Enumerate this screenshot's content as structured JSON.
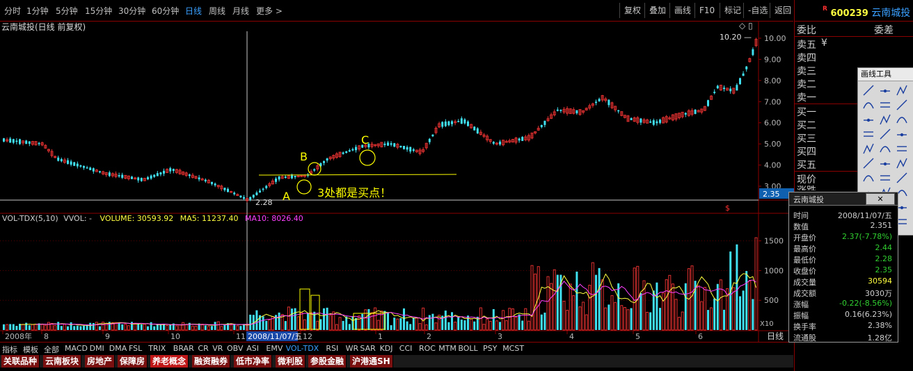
{
  "toolbar": {
    "periods": [
      "分时",
      "1分钟",
      "5分钟",
      "15分钟",
      "30分钟",
      "60分钟",
      "日线",
      "周线",
      "月线",
      "更多 >"
    ],
    "active_period": "日线",
    "right_buttons": [
      "复权",
      "叠加",
      "画线",
      "F10",
      "标记",
      "-自选",
      "返回"
    ]
  },
  "stock": {
    "code_marker": "R",
    "code": "600239",
    "name": "云南城投"
  },
  "chart": {
    "title": "云南城投(日线 前复权)",
    "high_label": "10.20",
    "low_label": "2.28",
    "current_price_tag": "2.35",
    "annotation_a": "A",
    "annotation_b": "B",
    "annotation_c": "C",
    "annotation_text": "3处都是买点！",
    "price_axis": [
      "10.00",
      "9.00",
      "8.00",
      "7.00",
      "6.00",
      "5.00",
      "4.00",
      "3.00"
    ],
    "vol_axis": [
      "1500",
      "1000",
      "500"
    ],
    "vol_multiplier": "X10",
    "vol_header": {
      "name": "VOL-TDX(5,10)",
      "vvol": "VVOL: -",
      "volume": "VOLUME: 30593.92",
      "ma5": "MA5: 11237.40",
      "ma10": "MA10: 8026.40"
    },
    "date_axis": [
      "2008年",
      "8",
      "9",
      "10",
      "11",
      "2008/11/07/五",
      "12",
      "1",
      "2",
      "3",
      "4",
      "5",
      "6"
    ],
    "period_label": "日线",
    "colors": {
      "up": "#e03030",
      "down": "#40e0f0",
      "ma5": "#ffff40",
      "ma10": "#ff40ff",
      "label": "#ffff00"
    }
  },
  "right_panel": {
    "header_left": "委比",
    "header_right": "委差",
    "sell": [
      "卖五",
      "卖四",
      "卖三",
      "卖二",
      "卖一"
    ],
    "sell5_extra": "¥",
    "buy": [
      "买一",
      "买二",
      "买三",
      "买四",
      "买五"
    ],
    "now": "现价",
    "partial": "涨跌"
  },
  "drawing_tools": {
    "title": "画线工具"
  },
  "info_popup": {
    "title": "云南城投",
    "rows": [
      {
        "k": "时间",
        "v": "2008/11/07/五",
        "c": "#d0d0d0"
      },
      {
        "k": "数值",
        "v": "2.351",
        "c": "#d0d0d0"
      },
      {
        "k": "开盘价",
        "v": "2.37(-7.78%)",
        "c": "#30d030"
      },
      {
        "k": "最高价",
        "v": "2.44",
        "c": "#30d030"
      },
      {
        "k": "最低价",
        "v": "2.28",
        "c": "#30d030"
      },
      {
        "k": "收盘价",
        "v": "2.35",
        "c": "#30d030"
      },
      {
        "k": "成交量",
        "v": "30594",
        "c": "#ffff40"
      },
      {
        "k": "成交额",
        "v": "3030万",
        "c": "#d0d0d0"
      },
      {
        "k": "涨幅",
        "v": "-0.22(-8.56%)",
        "c": "#30d030"
      },
      {
        "k": "振幅",
        "v": "0.16(6.23%)",
        "c": "#d0d0d0"
      },
      {
        "k": "换手率",
        "v": "2.38%",
        "c": "#d0d0d0"
      },
      {
        "k": "流通股",
        "v": "1.28亿",
        "c": "#d0d0d0"
      }
    ]
  },
  "indicator_tabs": [
    "指标",
    "模板",
    "全部",
    "MACD",
    "DMI",
    "DMA",
    "FSL",
    "TRIX",
    "BRAR",
    "CR",
    "VR",
    "OBV",
    "ASI",
    "EMV",
    "VOL-TDX",
    "RSI",
    "WR",
    "SAR",
    "KDJ",
    "CCI",
    "ROC",
    "MTM",
    "BOLL",
    "PSY",
    "MCST"
  ],
  "active_indicator": "VOL-TDX",
  "sector_tabs": [
    "关联品种",
    "云南板块",
    "房地产",
    "保障房",
    "养老概念",
    "融资融券",
    "低市净率",
    "微利股",
    "参股金融",
    "沪港通SH"
  ],
  "active_sector": "养老概念"
}
